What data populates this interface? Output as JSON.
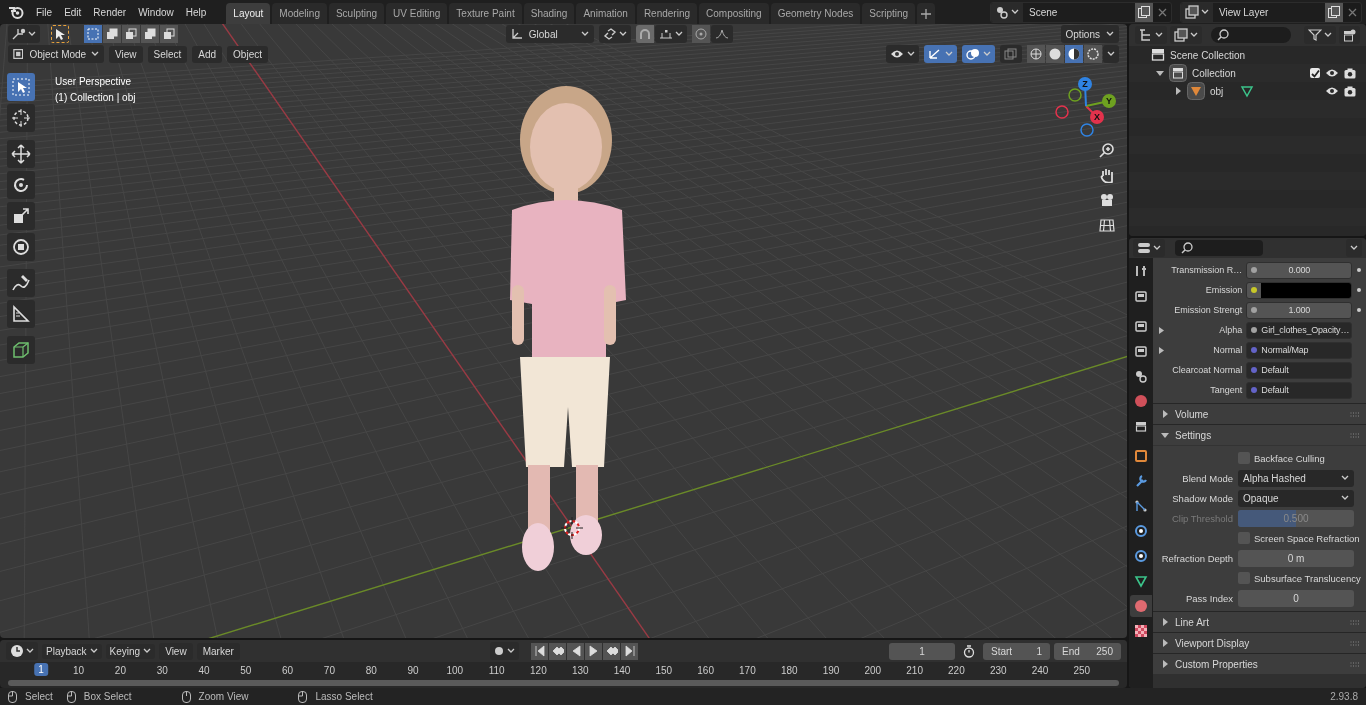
{
  "menu_bar": {
    "menus": [
      "File",
      "Edit",
      "Render",
      "Window",
      "Help"
    ]
  },
  "workspaces": [
    {
      "label": "Layout",
      "selected": true
    },
    {
      "label": "Modeling",
      "selected": false
    },
    {
      "label": "Sculpting",
      "selected": false
    },
    {
      "label": "UV Editing",
      "selected": false
    },
    {
      "label": "Texture Paint",
      "selected": false
    },
    {
      "label": "Shading",
      "selected": false
    },
    {
      "label": "Animation",
      "selected": false
    },
    {
      "label": "Rendering",
      "selected": false
    },
    {
      "label": "Compositing",
      "selected": false
    },
    {
      "label": "Geometry Nodes",
      "selected": false
    },
    {
      "label": "Scripting",
      "selected": false
    }
  ],
  "scene": {
    "name": "Scene"
  },
  "view_layer": {
    "name": "View Layer"
  },
  "viewport": {
    "select_modes": [
      {
        "selected": true
      },
      {
        "selected": false
      },
      {
        "selected": false
      },
      {
        "selected": false
      },
      {
        "selected": false
      }
    ],
    "transform_orientation": "Global",
    "options": "Options",
    "mode": "Object Mode",
    "menus": [
      "View",
      "Select",
      "Add",
      "Object"
    ],
    "toggles": [
      {
        "kind": "visibility",
        "on": false
      },
      {
        "kind": "gizmo",
        "on": true
      },
      {
        "kind": "overlay",
        "on": true
      },
      {
        "kind": "xray",
        "on": false
      }
    ],
    "shading": [
      {
        "kind": "wireframe",
        "selected": false
      },
      {
        "kind": "solid",
        "selected": false
      },
      {
        "kind": "material",
        "selected": true
      },
      {
        "kind": "rendered",
        "selected": false
      }
    ],
    "overlay_text": [
      "User Perspective",
      "(1) Collection | obj"
    ],
    "tools": [
      {
        "kind": "select",
        "selected": true
      },
      {
        "kind": "cursor",
        "selected": false
      },
      {
        "kind": "move",
        "selected": false
      },
      {
        "kind": "rotate",
        "selected": false
      },
      {
        "kind": "scale",
        "selected": false
      },
      {
        "kind": "transform",
        "selected": false
      },
      {
        "kind": "annotate",
        "selected": false
      },
      {
        "kind": "measure",
        "selected": false
      },
      {
        "kind": "add_cube",
        "selected": false
      }
    ],
    "gizmo_axes": [
      {
        "label": "X",
        "color": "#e3324c"
      },
      {
        "label": "Y",
        "color": "#6ea120"
      },
      {
        "label": "Z",
        "color": "#2f83e3"
      }
    ]
  },
  "outliner": {
    "items": [
      {
        "label": "Scene Collection",
        "kind": "scene_collection",
        "children": [
          {
            "label": "Collection",
            "kind": "collection",
            "expanded": true,
            "checked": true,
            "children": [
              {
                "label": "obj",
                "kind": "object",
                "expanded": false
              }
            ]
          }
        ]
      }
    ]
  },
  "properties": {
    "tabs": [
      {
        "kind": "tool",
        "selected": false
      },
      {
        "kind": "render",
        "selected": false
      },
      {
        "kind": "output",
        "selected": false
      },
      {
        "kind": "view_layer",
        "selected": false
      },
      {
        "kind": "scene",
        "selected": false
      },
      {
        "kind": "world",
        "selected": false
      },
      {
        "kind": "collection",
        "selected": false
      },
      {
        "kind": "object",
        "selected": false
      },
      {
        "kind": "modifiers",
        "selected": false
      },
      {
        "kind": "particles",
        "selected": false
      },
      {
        "kind": "physics",
        "selected": false
      },
      {
        "kind": "constraints",
        "selected": false
      },
      {
        "kind": "data",
        "selected": false
      },
      {
        "kind": "material",
        "selected": true
      },
      {
        "kind": "texture",
        "selected": false
      }
    ],
    "socket_rows": [
      {
        "kind": "value",
        "label": "Transmission R…",
        "color": "#a1a1a1",
        "value": "0.000",
        "expandable": false,
        "animatable": true
      },
      {
        "kind": "swatch",
        "label": "Emission",
        "color": "#c7c729",
        "swatch": {
          "color": "#000000"
        },
        "expandable": false,
        "animatable": true
      },
      {
        "kind": "value",
        "label": "Emission Strengt",
        "color": "#a1a1a1",
        "value": "1.000",
        "expandable": false,
        "animatable": true
      },
      {
        "kind": "link",
        "label": "Alpha",
        "color": "#a1a1a1",
        "value": "Girl_clothes_Opacity…",
        "expandable": true,
        "animatable": false
      },
      {
        "kind": "link",
        "label": "Normal",
        "color": "#6363c7",
        "value": "Normal/Map",
        "expandable": true,
        "animatable": false
      },
      {
        "kind": "link",
        "label": "Clearcoat Normal",
        "color": "#6363c7",
        "value": "Default",
        "expandable": false,
        "animatable": false
      },
      {
        "kind": "link",
        "label": "Tangent",
        "color": "#6363c7",
        "value": "Default",
        "expandable": false,
        "animatable": false
      }
    ],
    "panels": [
      {
        "label": "Volume",
        "expanded": false
      },
      {
        "label": "Settings",
        "expanded": true,
        "rows": [
          {
            "kind": "checkbox",
            "label": "Backface Culling",
            "checked": false,
            "disabled": false
          },
          {
            "kind": "dropdown",
            "label": "Blend Mode",
            "value": "Alpha Hashed",
            "disabled": false
          },
          {
            "kind": "dropdown",
            "label": "Shadow Mode",
            "value": "Opaque",
            "disabled": false
          },
          {
            "kind": "slider",
            "label": "Clip Threshold",
            "value": "0.500",
            "level": 0.5,
            "disabled": true
          },
          {
            "kind": "checkbox",
            "label": "Screen Space Refraction",
            "checked": false,
            "disabled": false
          },
          {
            "kind": "number",
            "label": "Refraction Depth",
            "value": "0 m",
            "disabled": false
          },
          {
            "kind": "checkbox",
            "label": "Subsurface Translucency",
            "checked": false,
            "disabled": false
          },
          {
            "kind": "number",
            "label": "Pass Index",
            "value": "0",
            "disabled": false
          }
        ]
      },
      {
        "label": "Line Art",
        "expanded": false
      },
      {
        "label": "Viewport Display",
        "expanded": false
      },
      {
        "label": "Custom Properties",
        "expanded": false
      }
    ]
  },
  "timeline": {
    "dropdowns": [
      "Playback",
      "Keying"
    ],
    "menus": [
      "View",
      "Marker"
    ],
    "current_frame": "1",
    "start_label": "Start",
    "start": "1",
    "end_label": "End",
    "end": "250",
    "ruler": [
      {
        "label": "1",
        "selected": true
      },
      {
        "label": "10",
        "selected": false
      },
      {
        "label": "20",
        "selected": false
      },
      {
        "label": "30",
        "selected": false
      },
      {
        "label": "40",
        "selected": false
      },
      {
        "label": "50",
        "selected": false
      },
      {
        "label": "60",
        "selected": false
      },
      {
        "label": "70",
        "selected": false
      },
      {
        "label": "80",
        "selected": false
      },
      {
        "label": "90",
        "selected": false
      },
      {
        "label": "100",
        "selected": false
      },
      {
        "label": "110",
        "selected": false
      },
      {
        "label": "120",
        "selected": false
      },
      {
        "label": "130",
        "selected": false
      },
      {
        "label": "140",
        "selected": false
      },
      {
        "label": "150",
        "selected": false
      },
      {
        "label": "160",
        "selected": false
      },
      {
        "label": "170",
        "selected": false
      },
      {
        "label": "180",
        "selected": false
      },
      {
        "label": "190",
        "selected": false
      },
      {
        "label": "200",
        "selected": false
      },
      {
        "label": "210",
        "selected": false
      },
      {
        "label": "220",
        "selected": false
      },
      {
        "label": "230",
        "selected": false
      },
      {
        "label": "240",
        "selected": false
      },
      {
        "label": "250",
        "selected": false
      }
    ]
  },
  "status_bar": {
    "hints": [
      "Select",
      "Box Select",
      "Zoom View",
      "Lasso Select"
    ],
    "version": "2.93.8"
  }
}
